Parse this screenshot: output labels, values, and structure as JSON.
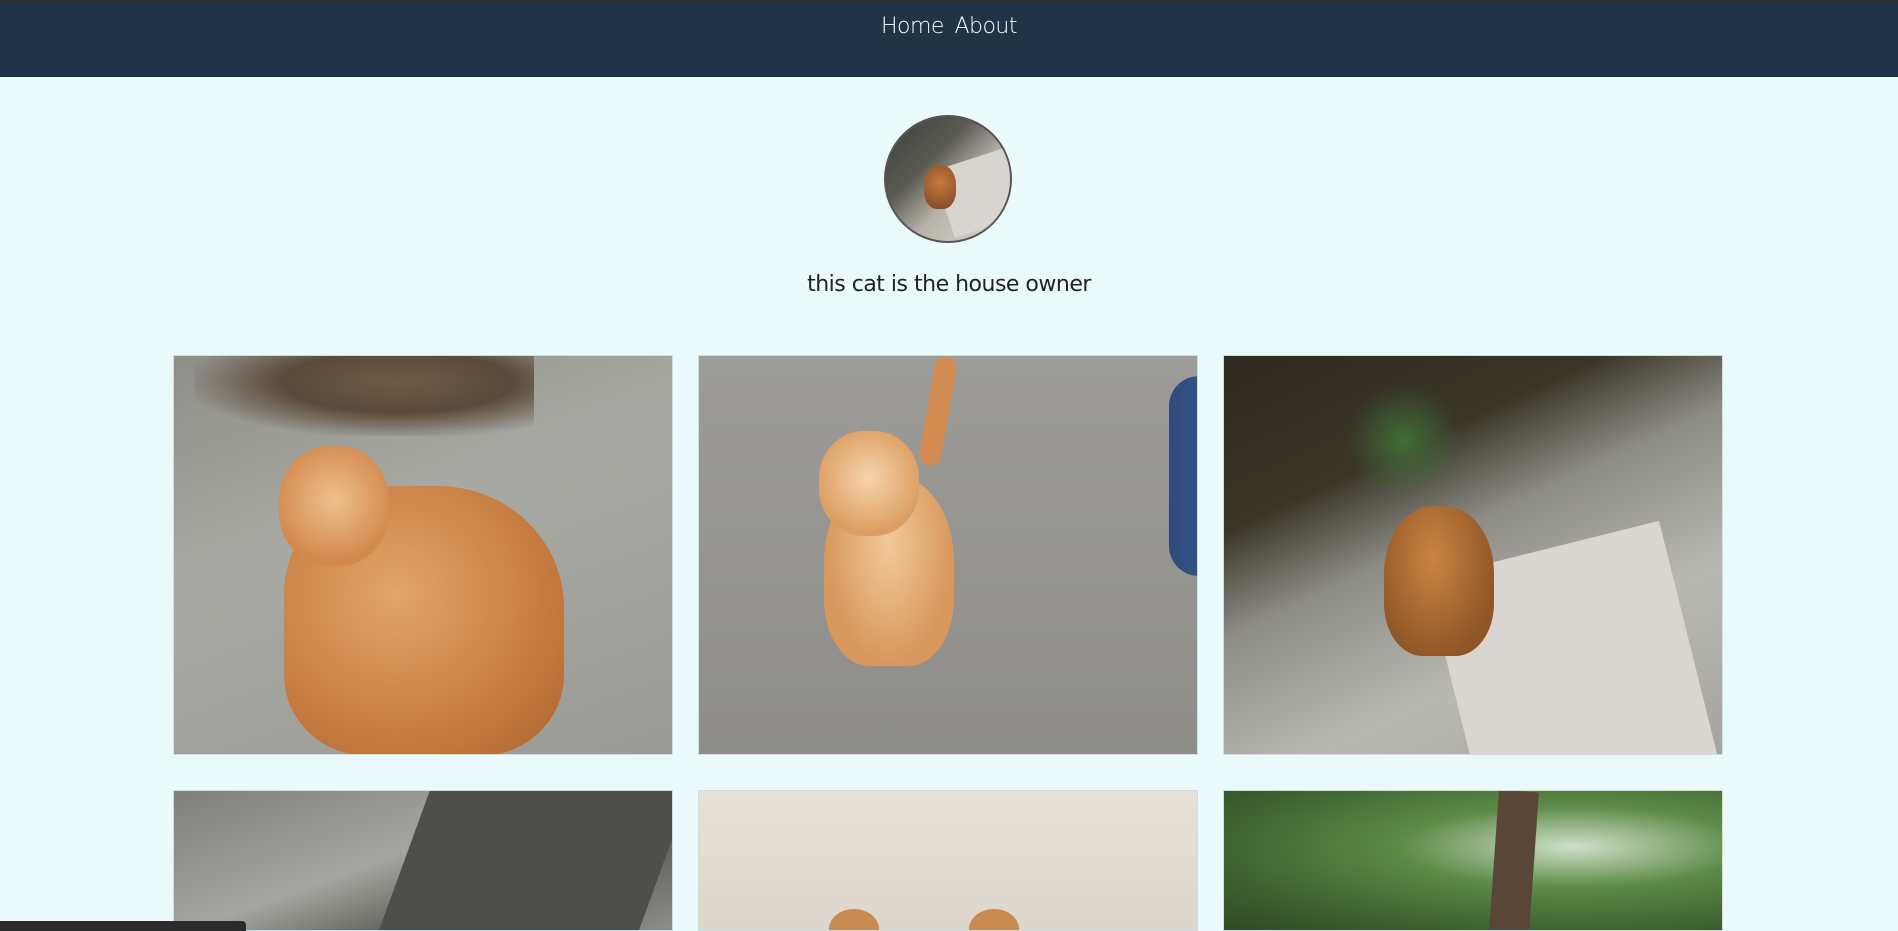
{
  "navbar": {
    "links": [
      "Home",
      "About"
    ]
  },
  "profile": {
    "caption": "this cat is the house owner"
  },
  "gallery": {
    "photo_count": 6
  }
}
